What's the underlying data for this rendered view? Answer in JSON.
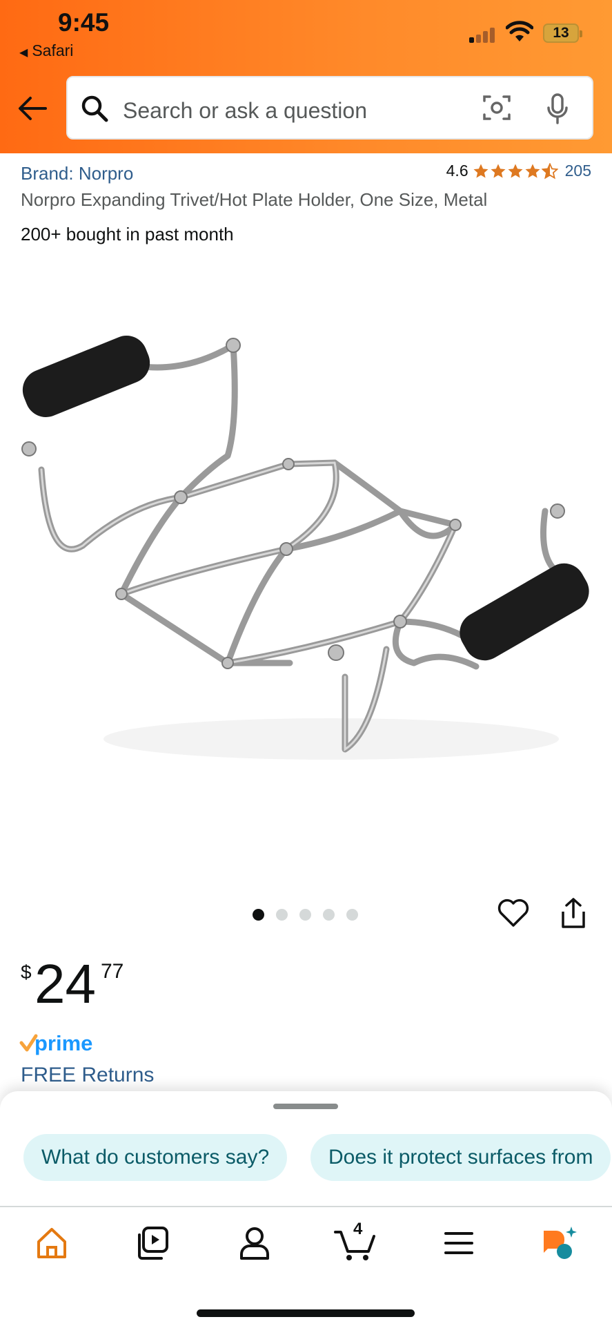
{
  "status_bar": {
    "time": "9:45",
    "back_app": "Safari",
    "battery": "13"
  },
  "search": {
    "placeholder": "Search or ask a question"
  },
  "product": {
    "brand": "Brand: Norpro",
    "rating": "4.6",
    "rating_value": 4.6,
    "review_count": "205",
    "title": "Norpro Expanding Trivet/Hot Plate Holder, One Size, Metal",
    "bought": "200+ bought in past month"
  },
  "gallery": {
    "count": 5,
    "active_index": 0
  },
  "price": {
    "currency": "$",
    "whole": "24",
    "fraction": "77"
  },
  "prime_label": "prime",
  "free_returns": "FREE Returns",
  "chips": [
    "What do customers say?",
    "Does it protect surfaces from"
  ],
  "nav": {
    "cart_count": "4"
  },
  "colors": {
    "header": "#ff7a1f",
    "link": "#2f5d8c",
    "star": "#de7921",
    "chip_bg": "#dff5f7",
    "active_nav": "#e47911"
  }
}
